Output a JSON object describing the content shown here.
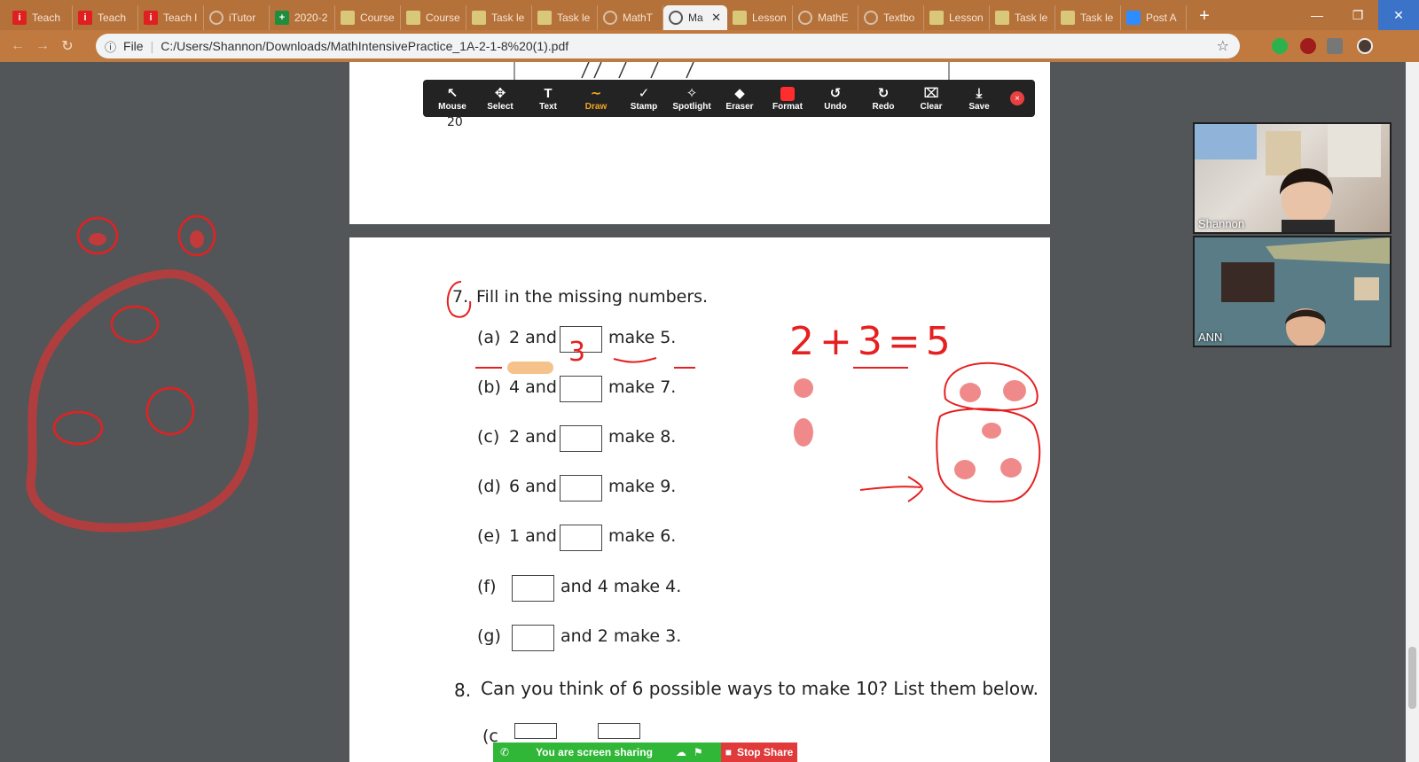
{
  "browser": {
    "tabs": [
      {
        "label": "Teach",
        "icon": "i",
        "color": "#e02020"
      },
      {
        "label": "Teach",
        "icon": "i",
        "color": "#e02020"
      },
      {
        "label": "Teach l",
        "icon": "i",
        "color": "#e02020"
      },
      {
        "label": "iTutor",
        "icon": "globe",
        "color": "#777"
      },
      {
        "label": "2020-2",
        "icon": "+",
        "color": "#1e8e3e"
      },
      {
        "label": "Course",
        "icon": "doc",
        "color": "#d9c77a"
      },
      {
        "label": "Course",
        "icon": "doc",
        "color": "#d9c77a"
      },
      {
        "label": "Task le",
        "icon": "doc",
        "color": "#d9c77a"
      },
      {
        "label": "Task le",
        "icon": "doc",
        "color": "#d9c77a"
      },
      {
        "label": "MathT",
        "icon": "globe",
        "color": "#777"
      },
      {
        "label": "Ma",
        "icon": "globe",
        "color": "#777",
        "active": true
      },
      {
        "label": "Lesson",
        "icon": "doc",
        "color": "#d9c77a"
      },
      {
        "label": "MathE",
        "icon": "globe",
        "color": "#777"
      },
      {
        "label": "Textbo",
        "icon": "globe",
        "color": "#777"
      },
      {
        "label": "Lesson",
        "icon": "doc",
        "color": "#d9c77a"
      },
      {
        "label": "Task le",
        "icon": "doc",
        "color": "#d9c77a"
      },
      {
        "label": "Task le",
        "icon": "doc",
        "color": "#d9c77a"
      },
      {
        "label": "Post A",
        "icon": "cam",
        "color": "#2d8cff"
      }
    ],
    "new_tab": "+",
    "file_label": "File",
    "url": "C:/Users/Shannon/Downloads/MathIntensivePractice_1A-2-1-8%20(1).pdf"
  },
  "annotation_toolbar": {
    "tools": [
      {
        "label": "Mouse",
        "icon": "↖"
      },
      {
        "label": "Select",
        "icon": "✥"
      },
      {
        "label": "Text",
        "icon": "T"
      },
      {
        "label": "Draw",
        "icon": "∼",
        "active": true
      },
      {
        "label": "Stamp",
        "icon": "✓"
      },
      {
        "label": "Spotlight",
        "icon": "✧"
      },
      {
        "label": "Eraser",
        "icon": "◆"
      },
      {
        "label": "Format",
        "icon": "color"
      },
      {
        "label": "Undo",
        "icon": "↺"
      },
      {
        "label": "Redo",
        "icon": "↻"
      },
      {
        "label": "Clear",
        "icon": "⌧"
      },
      {
        "label": "Save",
        "icon": "⤓"
      }
    ],
    "close": "×"
  },
  "page1": {
    "number_fragment": "20"
  },
  "worksheet": {
    "q7_number": "7.",
    "q7_title": "Fill in the missing numbers.",
    "items": [
      {
        "label": "(a)",
        "before": "2 and",
        "after": "make 5."
      },
      {
        "label": "(b)",
        "before": "4 and",
        "after": "make 7."
      },
      {
        "label": "(c)",
        "before": "2 and",
        "after": "make 8."
      },
      {
        "label": "(d)",
        "before": "6 and",
        "after": "make 9."
      },
      {
        "label": "(e)",
        "before": "1 and",
        "after": "make 6."
      },
      {
        "label": "(f)",
        "before": "",
        "after": "and 4 make 4."
      },
      {
        "label": "(g)",
        "before": "",
        "after": "and 2 make 3."
      }
    ],
    "q8_number": "8.",
    "q8_title": "Can you think of 6 possible ways to make 10? List them below.",
    "q8_fragment": "(c"
  },
  "ink": {
    "box_a_answer": "3",
    "equation": "2+3=5",
    "ink_color": "#e62020",
    "ink_light": "#f08a8a"
  },
  "participants": [
    {
      "name": "Shannon"
    },
    {
      "name": "ANN"
    }
  ],
  "screen_share": {
    "status": "You are screen sharing",
    "stop_label": "Stop Share"
  }
}
